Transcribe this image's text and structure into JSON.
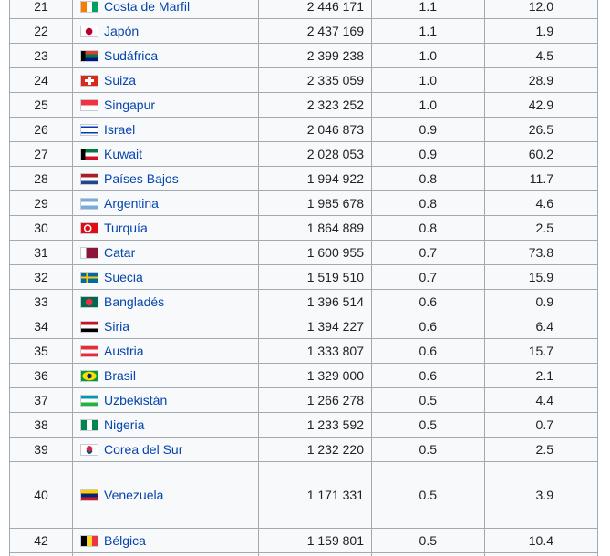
{
  "rows": [
    {
      "rank": "21",
      "country": "Costa de Marfil",
      "value": "2 446 171",
      "share": "1.1",
      "growth": "12.0",
      "flag_icon": "cote-divoire-flag-icon",
      "flag_colors": [
        "#f77f00",
        "#ffffff",
        "#009e60"
      ],
      "flag_style": "v3"
    },
    {
      "rank": "22",
      "country": "Japón",
      "value": "2 437 169",
      "share": "1.1",
      "growth": "1.9",
      "flag_icon": "japan-flag-icon",
      "flag_colors": [
        "#ffffff",
        "#bc002d"
      ],
      "flag_style": "disc"
    },
    {
      "rank": "23",
      "country": "Sudáfrica",
      "value": "2 399 238",
      "share": "1.0",
      "growth": "4.5",
      "flag_icon": "south-africa-flag-icon",
      "flag_colors": [
        "#e03c31",
        "#007749",
        "#001489",
        "#ffb612",
        "#000000"
      ],
      "flag_style": "za"
    },
    {
      "rank": "24",
      "country": "Suiza",
      "value": "2 335 059",
      "share": "1.0",
      "growth": "28.9",
      "flag_icon": "switzerland-flag-icon",
      "flag_colors": [
        "#da291c",
        "#ffffff"
      ],
      "flag_style": "cross"
    },
    {
      "rank": "25",
      "country": "Singapur",
      "value": "2 323 252",
      "share": "1.0",
      "growth": "42.9",
      "flag_icon": "singapore-flag-icon",
      "flag_colors": [
        "#ef3340",
        "#ffffff"
      ],
      "flag_style": "h2"
    },
    {
      "rank": "26",
      "country": "Israel",
      "value": "2 046 873",
      "share": "0.9",
      "growth": "26.5",
      "flag_icon": "israel-flag-icon",
      "flag_colors": [
        "#ffffff",
        "#0038b8"
      ],
      "flag_style": "il"
    },
    {
      "rank": "27",
      "country": "Kuwait",
      "value": "2 028 053",
      "share": "0.9",
      "growth": "60.2",
      "flag_icon": "kuwait-flag-icon",
      "flag_colors": [
        "#007a3d",
        "#ffffff",
        "#ce1126",
        "#000000"
      ],
      "flag_style": "kw"
    },
    {
      "rank": "28",
      "country": "Países Bajos",
      "value": "1 994 922",
      "share": "0.8",
      "growth": "11.7",
      "flag_icon": "netherlands-flag-icon",
      "flag_colors": [
        "#ae1c28",
        "#ffffff",
        "#21468b"
      ],
      "flag_style": "h3"
    },
    {
      "rank": "29",
      "country": "Argentina",
      "value": "1 985 678",
      "share": "0.8",
      "growth": "4.6",
      "flag_icon": "argentina-flag-icon",
      "flag_colors": [
        "#74acdf",
        "#ffffff",
        "#74acdf"
      ],
      "flag_style": "h3"
    },
    {
      "rank": "30",
      "country": "Turquía",
      "value": "1 864 889",
      "share": "0.8",
      "growth": "2.5",
      "flag_icon": "turkey-flag-icon",
      "flag_colors": [
        "#e30a17",
        "#ffffff"
      ],
      "flag_style": "tr"
    },
    {
      "rank": "31",
      "country": "Catar",
      "value": "1 600 955",
      "share": "0.7",
      "growth": "73.8",
      "flag_icon": "qatar-flag-icon",
      "flag_colors": [
        "#8a1538",
        "#ffffff"
      ],
      "flag_style": "qa"
    },
    {
      "rank": "32",
      "country": "Suecia",
      "value": "1 519 510",
      "share": "0.7",
      "growth": "15.9",
      "flag_icon": "sweden-flag-icon",
      "flag_colors": [
        "#006aa7",
        "#fecc00"
      ],
      "flag_style": "nordic"
    },
    {
      "rank": "33",
      "country": "Bangladés",
      "value": "1 396 514",
      "share": "0.6",
      "growth": "0.9",
      "flag_icon": "bangladesh-flag-icon",
      "flag_colors": [
        "#006a4e",
        "#f42a41"
      ],
      "flag_style": "disc"
    },
    {
      "rank": "34",
      "country": "Siria",
      "value": "1 394 227",
      "share": "0.6",
      "growth": "6.4",
      "flag_icon": "syria-flag-icon",
      "flag_colors": [
        "#ce1126",
        "#ffffff",
        "#000000"
      ],
      "flag_style": "h3"
    },
    {
      "rank": "35",
      "country": "Austria",
      "value": "1 333 807",
      "share": "0.6",
      "growth": "15.7",
      "flag_icon": "austria-flag-icon",
      "flag_colors": [
        "#ed2939",
        "#ffffff",
        "#ed2939"
      ],
      "flag_style": "h3"
    },
    {
      "rank": "36",
      "country": "Brasil",
      "value": "1 329 000",
      "share": "0.6",
      "growth": "2.1",
      "flag_icon": "brazil-flag-icon",
      "flag_colors": [
        "#009c3b",
        "#ffdf00",
        "#002776"
      ],
      "flag_style": "br"
    },
    {
      "rank": "37",
      "country": "Uzbekistán",
      "value": "1 266 278",
      "share": "0.5",
      "growth": "4.4",
      "flag_icon": "uzbekistan-flag-icon",
      "flag_colors": [
        "#0099b5",
        "#ffffff",
        "#1eb53a"
      ],
      "flag_style": "h3"
    },
    {
      "rank": "38",
      "country": "Nigeria",
      "value": "1 233 592",
      "share": "0.5",
      "growth": "0.7",
      "flag_icon": "nigeria-flag-icon",
      "flag_colors": [
        "#008751",
        "#ffffff",
        "#008751"
      ],
      "flag_style": "v3"
    },
    {
      "rank": "39",
      "country": "Corea del Sur",
      "value": "1 232 220",
      "share": "0.5",
      "growth": "2.5",
      "flag_icon": "south-korea-flag-icon",
      "flag_colors": [
        "#ffffff",
        "#cd2e3a",
        "#0047a0"
      ],
      "flag_style": "kr"
    },
    {
      "rank": "40",
      "country": "Venezuela",
      "value": "1 171 331",
      "share": "0.5",
      "growth": "3.9",
      "flag_icon": "venezuela-flag-icon",
      "flag_colors": [
        "#ffcc00",
        "#00247d",
        "#cf142b"
      ],
      "flag_style": "h3",
      "tall": true
    },
    {
      "rank": "42",
      "country": "Bélgica",
      "value": "1 159 801",
      "share": "0.5",
      "growth": "10.4",
      "flag_icon": "belgium-flag-icon",
      "flag_colors": [
        "#000000",
        "#fdda24",
        "#ef3340"
      ],
      "flag_style": "v3"
    },
    {
      "rank": "",
      "country": "",
      "value": "",
      "share": "",
      "growth": "",
      "flag_icon": "",
      "flag_colors": [],
      "flag_style": "none"
    }
  ]
}
